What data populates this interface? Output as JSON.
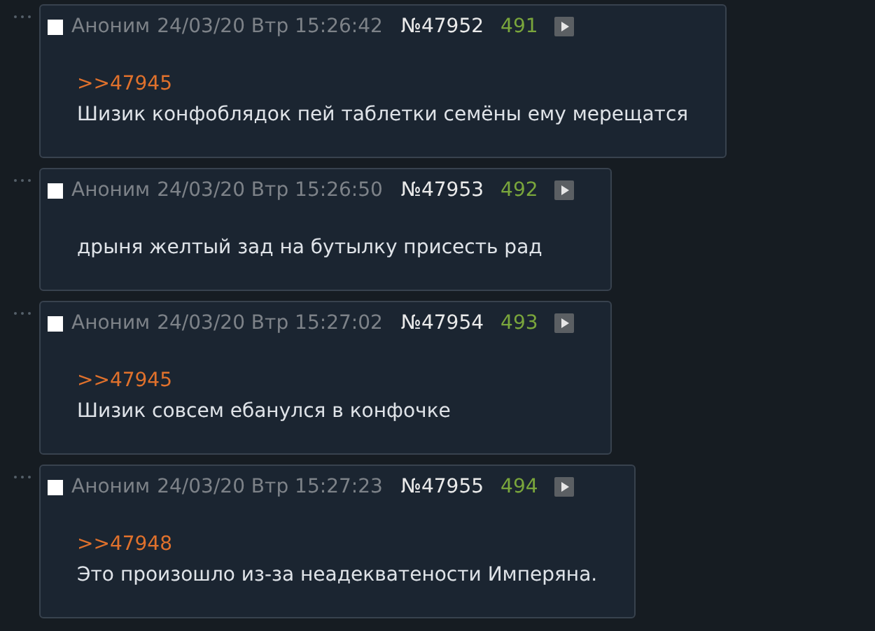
{
  "posts": [
    {
      "checked": false,
      "name": "Аноним",
      "date": "24/03/20 Втр 15:26:42",
      "number": "№47952",
      "index": "491",
      "reply_to": ">>47945",
      "text": "Шизик конфоблядок пей таблетки семёны ему мерещатся"
    },
    {
      "checked": false,
      "name": "Аноним",
      "date": "24/03/20 Втр 15:26:50",
      "number": "№47953",
      "index": "492",
      "text": "дрыня желтый зад на бутылку присесть рад"
    },
    {
      "checked": false,
      "name": "Аноним",
      "date": "24/03/20 Втр 15:27:02",
      "number": "№47954",
      "index": "493",
      "reply_to": ">>47945",
      "text": "Шизик совсем ебанулся в конфочке"
    },
    {
      "checked": false,
      "name": "Аноним",
      "date": "24/03/20 Втр 15:27:23",
      "number": "№47955",
      "index": "494",
      "reply_to": ">>47948",
      "text": "Это произошло из-за неадекватености Имперяна."
    }
  ]
}
